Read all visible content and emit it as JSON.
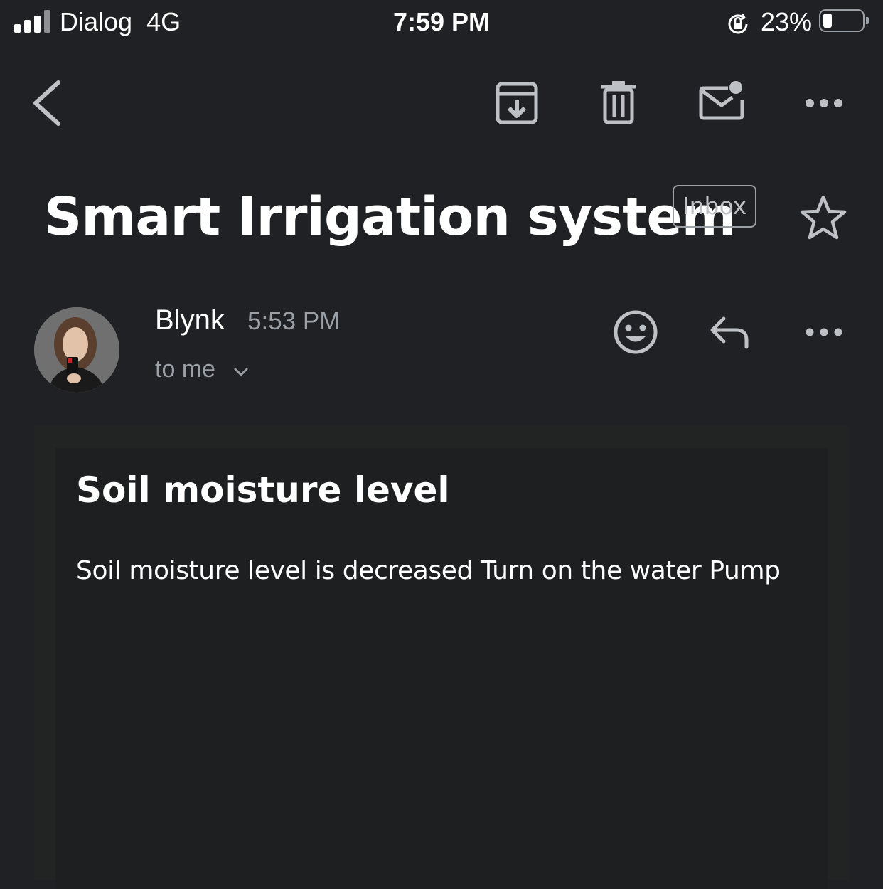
{
  "status_bar": {
    "carrier": "Dialog",
    "network": "4G",
    "time": "7:59 PM",
    "battery_percent": "23%",
    "signal_bars": 3,
    "battery_level": 0.23
  },
  "toolbar": {
    "icons": [
      "back-icon",
      "archive-icon",
      "trash-icon",
      "mark-unread-icon",
      "more-icon"
    ]
  },
  "email": {
    "subject": "Smart Irrigation system",
    "label": "Inbox",
    "sender": "Blynk",
    "time": "5:53 PM",
    "recipient": "to me",
    "body_title": "Soil moisture level",
    "body_text": "Soil moisture level is decreased Turn on the water Pump"
  },
  "colors": {
    "background": "#202124",
    "text_primary": "#ffffff",
    "text_secondary": "#9aa0a6",
    "icon": "#bdc1c6"
  }
}
